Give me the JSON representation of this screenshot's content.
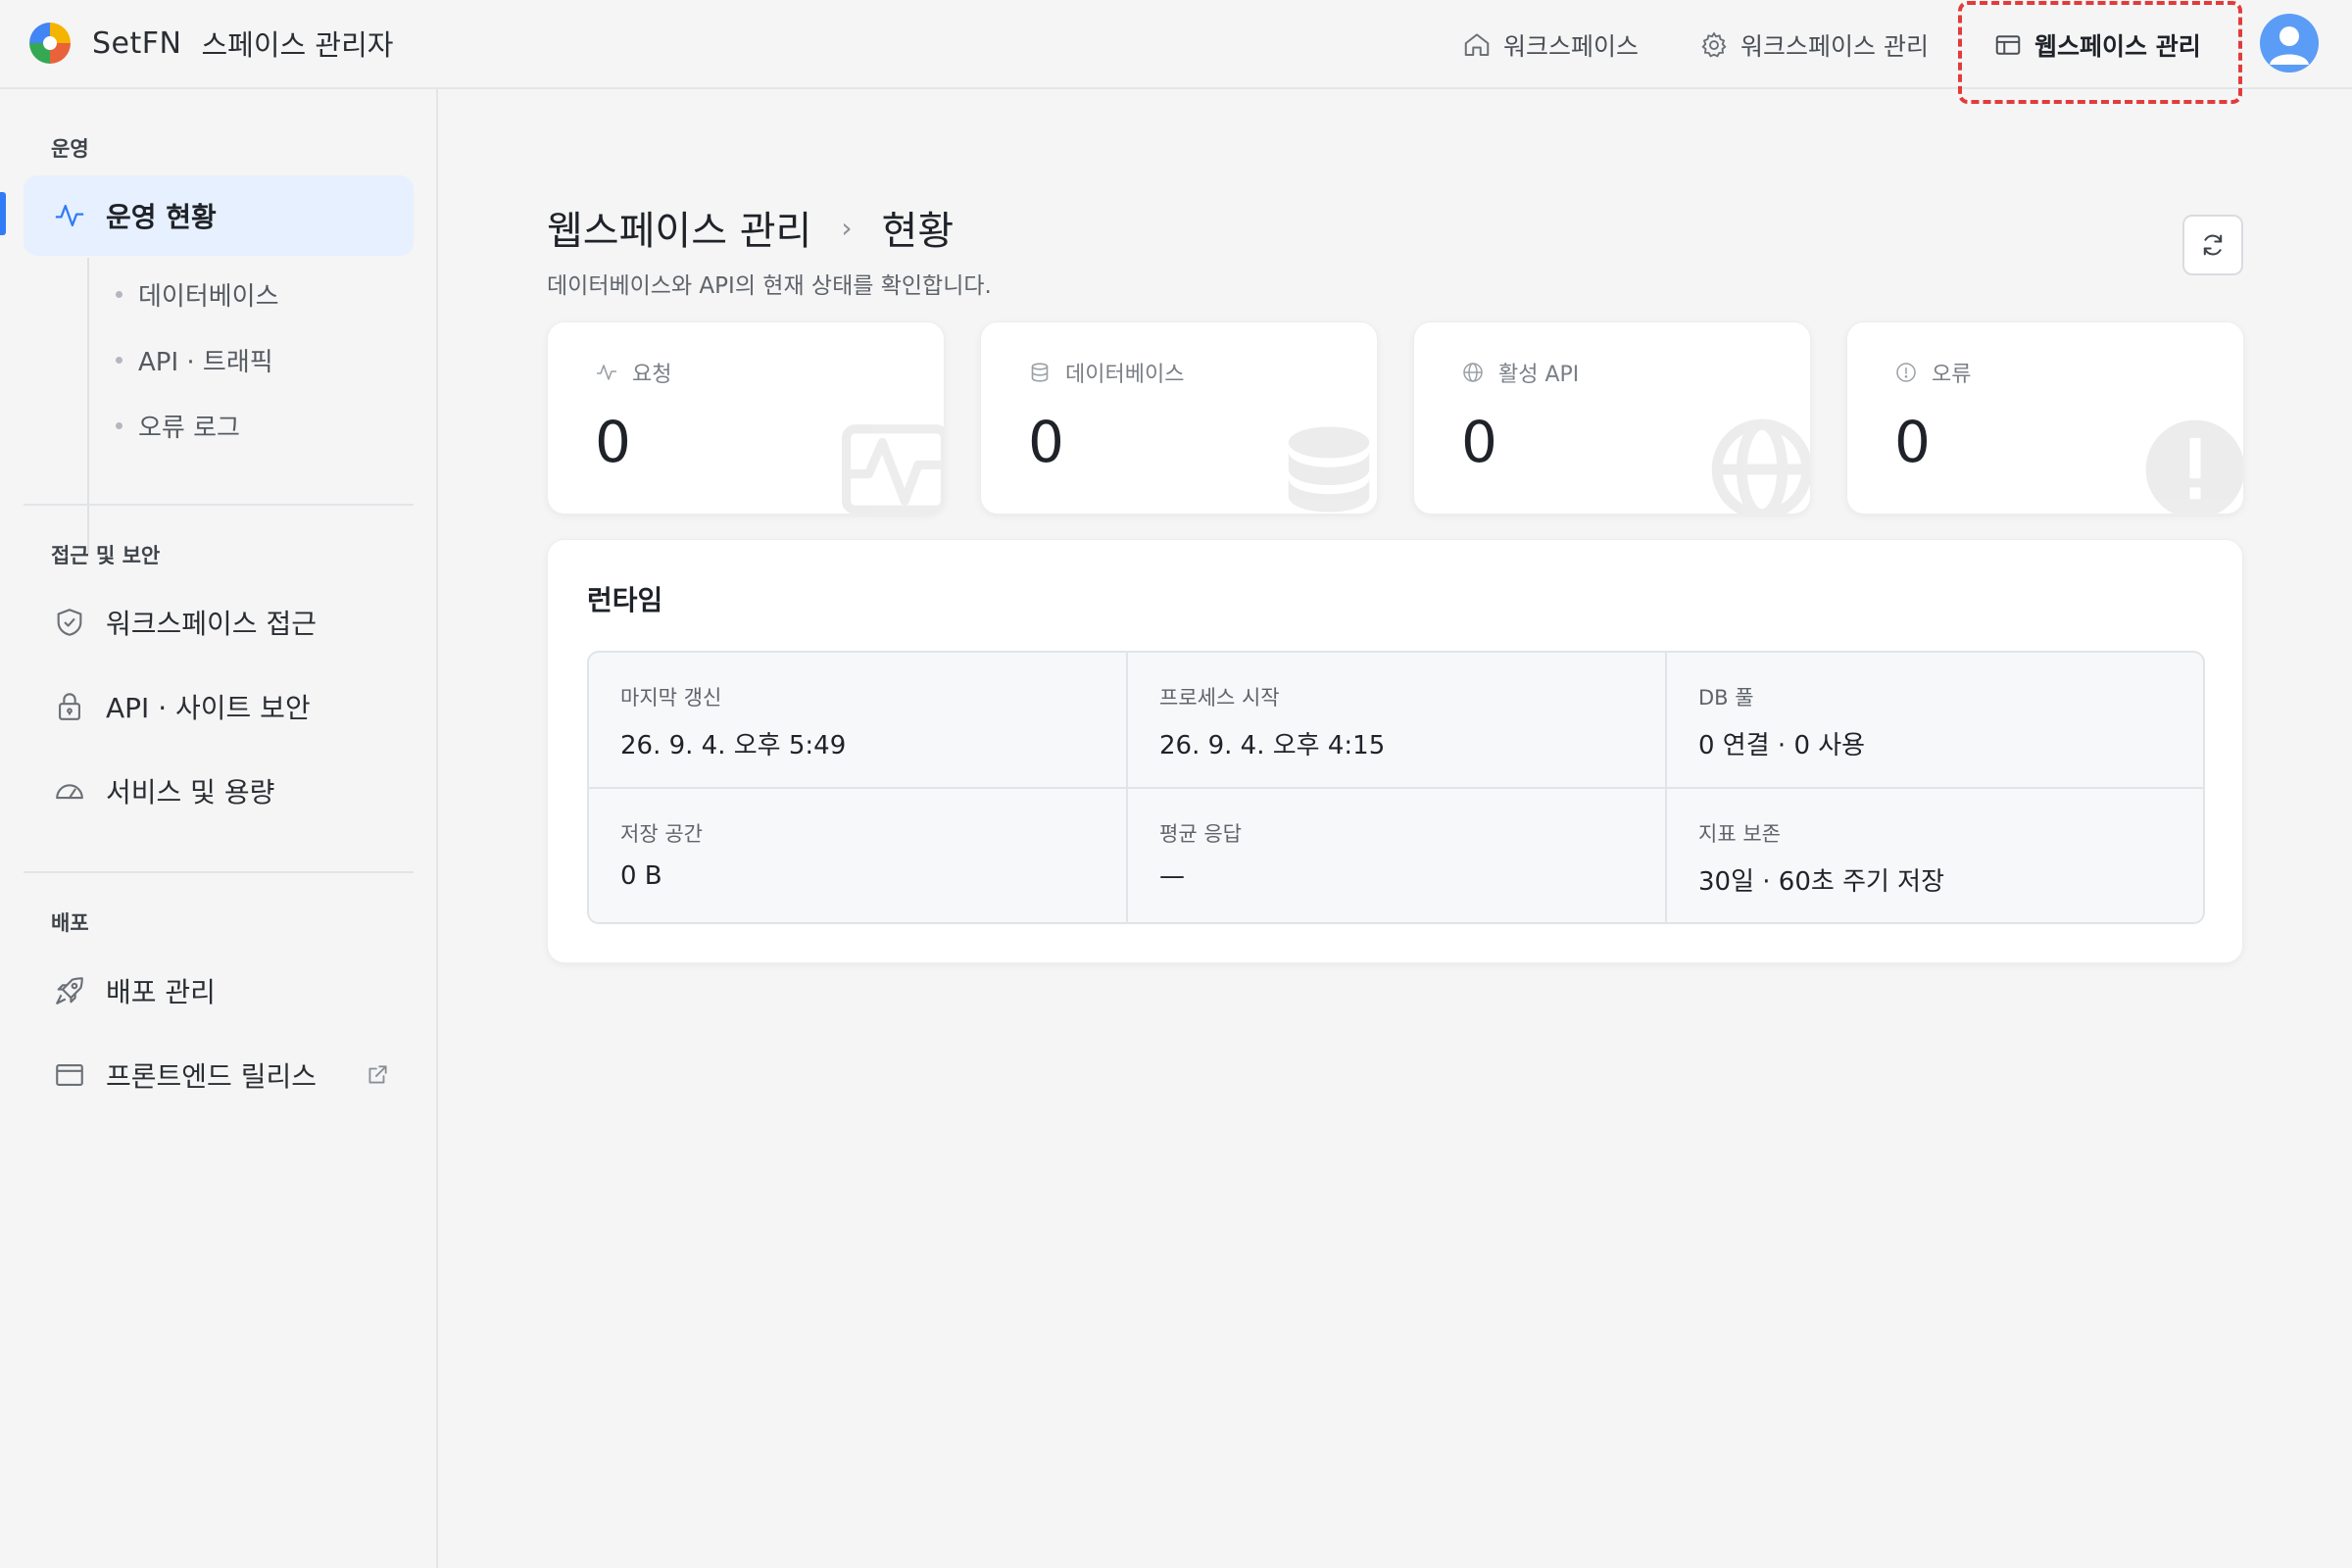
{
  "header": {
    "brand_name": "SetFN",
    "brand_subtitle": "스페이스 관리자",
    "nav": {
      "workspace": "워크스페이스",
      "workspace_manage": "워크스페이스 관리",
      "webspace_manage": "웹스페이스 관리"
    },
    "icons": [
      "logo-icon",
      "home-icon",
      "gear-icon",
      "layout-icon",
      "avatar-icon"
    ],
    "accent_color": "#2f7cf6",
    "highlight_color": "#e23b3b"
  },
  "sidebar": {
    "sections": {
      "operations": "운영",
      "access": "접근 및 보안",
      "deploy": "배포"
    },
    "items": {
      "ops_status": "운영 현황",
      "database": "데이터베이스",
      "api_traffic": "API · 트래픽",
      "error_log": "오류 로그",
      "ws_access": "워크스페이스 접근",
      "api_site_security": "API · 사이트 보안",
      "service_usage": "서비스 및 용량",
      "deploy_manage": "배포 관리",
      "frontend_release": "프론트엔드 릴리스"
    }
  },
  "main": {
    "breadcrumb": [
      "웹스페이스 관리",
      "현황"
    ],
    "breadcrumb_sep": "›",
    "subtitle": "데이터베이스와 API의 현재 상태를 확인합니다.",
    "stats": [
      {
        "label": "요청",
        "value": "0",
        "icon": "activity-icon"
      },
      {
        "label": "데이터베이스",
        "value": "0",
        "icon": "database-icon"
      },
      {
        "label": "활성 API",
        "value": "0",
        "icon": "globe-icon"
      },
      {
        "label": "오류",
        "value": "0",
        "icon": "alert-circle-icon"
      }
    ],
    "runtime": {
      "title": "런타임",
      "rows": [
        [
          {
            "label": "마지막 갱신",
            "value": "26. 9. 4. 오후 5:49"
          },
          {
            "label": "프로세스 시작",
            "value": "26. 9. 4. 오후 4:15"
          },
          {
            "label": "DB 풀",
            "value": "0 연결 · 0 사용"
          }
        ],
        [
          {
            "label": "저장 공간",
            "value": "0 B"
          },
          {
            "label": "평균 응답",
            "value": "—"
          },
          {
            "label": "지표 보존",
            "value": "30일 · 60초 주기 저장"
          }
        ]
      ]
    }
  }
}
